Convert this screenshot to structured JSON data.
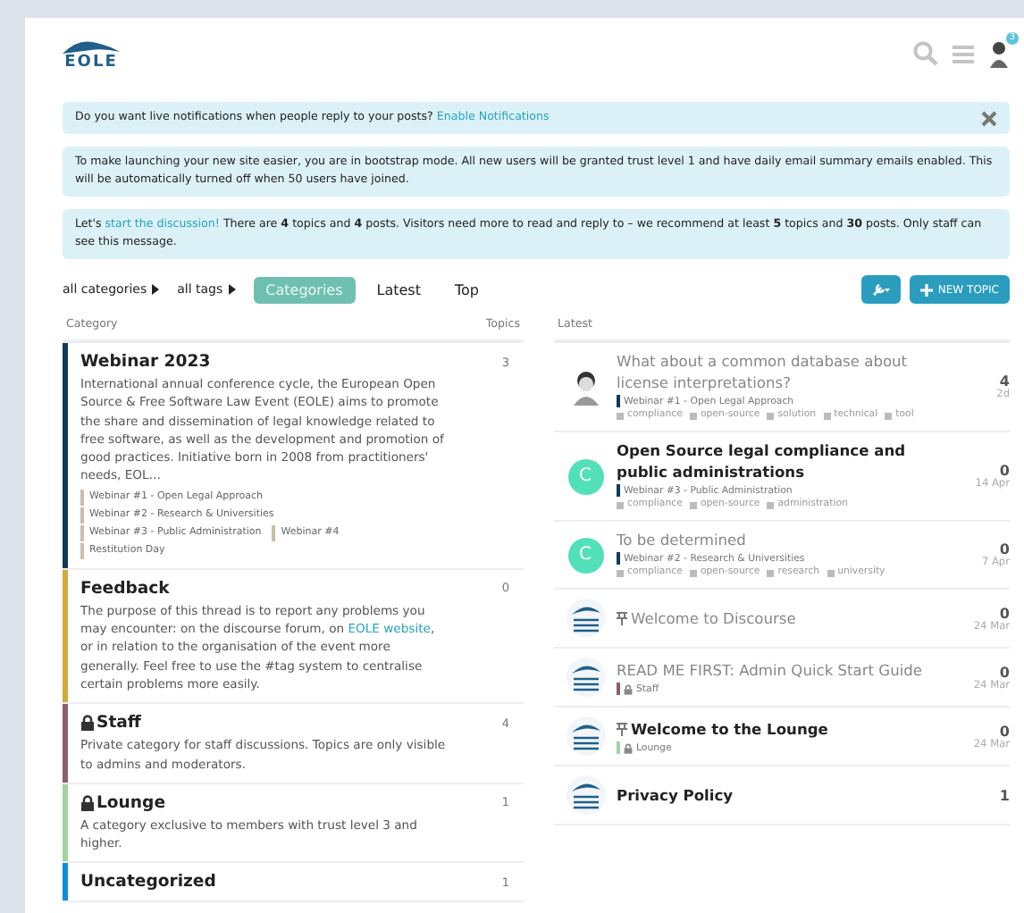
{
  "header": {
    "logo_text": "EOLE",
    "notification_count": "3"
  },
  "banners": [
    {
      "text": "Do you want live notifications when people reply to your posts? ",
      "link": "Enable Notifications",
      "dismissible": true
    },
    {
      "text": "To make launching your new site easier, you are in bootstrap mode. All new users will be granted trust level 1 and have daily email summary emails enabled. This will be automatically turned off when 50 users have joined.",
      "dismissible": false
    },
    {
      "text": "Let's ",
      "link": "start the discussion!",
      "after": " There are **4** topics and **4** posts. Visitors need more to read and reply to – we recommend at least **5** topics and **30** posts. Only staff can see this message.",
      "dismissible": false
    }
  ],
  "nav": {
    "filters": [
      "all categories",
      "all tags"
    ],
    "tabs": [
      {
        "label": "Categories",
        "selected": true
      },
      {
        "label": "Latest",
        "selected": false
      },
      {
        "label": "Top",
        "selected": false
      }
    ],
    "new_topic": "NEW TOPIC"
  },
  "categories": {
    "columns": [
      "Category",
      "Topics"
    ],
    "rows": [
      {
        "name": "Webinar 2023",
        "color": "#123a58",
        "locked": false,
        "topics": "3",
        "description": "International annual conference cycle, the European Open Source & Free Software Law Event (EOLE) aims to promote the share and dissemination of legal knowledge related to free software, as well as the development and promotion of good practices. Initiative born in 2008 from practitioners' needs, EOL…",
        "subcategories": [
          "Webinar #1 - Open Legal Approach",
          "Webinar #2 - Research & Universities",
          "Webinar #3 - Public Administration",
          "Webinar #4",
          "Restitution Day"
        ]
      },
      {
        "name": "Feedback",
        "color": "#d2aa3c",
        "locked": false,
        "topics": "0",
        "description": "The purpose of this thread is to report any problems you may encounter: on the discourse forum, on ",
        "link": "EOLE website",
        "after": ", or in relation to the organisation of the event more generally. Feel free to use the #tag system to centralise certain problems more easily."
      },
      {
        "name": "Staff",
        "color": "#8c5f6e",
        "locked": true,
        "topics": "4",
        "description": "Private category for staff discussions. Topics are only visible to admins and moderators."
      },
      {
        "name": "Lounge",
        "color": "#a3d3a3",
        "locked": true,
        "topics": "1",
        "description": "A category exclusive to members with trust level 3 and higher."
      },
      {
        "name": "Uncategorized",
        "color": "#0b8fd6",
        "locked": false,
        "topics": "1"
      }
    ]
  },
  "latest": {
    "heading": "Latest",
    "topics": [
      {
        "title": "What about a common database about license interpretations?",
        "unread": false,
        "pinned": false,
        "kind": "photo",
        "category": {
          "name": "Webinar #1 - Open Legal Approach",
          "color": "#123a58",
          "locked": false
        },
        "tags": [
          "compliance",
          "open-source",
          "solution",
          "technical",
          "tool"
        ],
        "replies": "4",
        "date": "2d"
      },
      {
        "title": "Open Source legal compliance and public administrations",
        "unread": true,
        "pinned": false,
        "kind": "letter",
        "letter": "C",
        "category": {
          "name": "Webinar #3 - Public Administration",
          "color": "#123a58",
          "locked": false
        },
        "tags": [
          "compliance",
          "open-source",
          "administration"
        ],
        "replies": "0",
        "date": "14 Apr"
      },
      {
        "title": "To be determined",
        "unread": false,
        "pinned": false,
        "kind": "letter",
        "letter": "C",
        "category": {
          "name": "Webinar #2 - Research & Universities",
          "color": "#123a58",
          "locked": false
        },
        "tags": [
          "compliance",
          "open-source",
          "research",
          "university"
        ],
        "replies": "0",
        "date": "7 Apr"
      },
      {
        "title": "Welcome to Discourse",
        "unread": false,
        "pinned": true,
        "kind": "logo",
        "replies": "0",
        "date": "24 Mar"
      },
      {
        "title": "READ ME FIRST: Admin Quick Start Guide",
        "unread": false,
        "pinned": false,
        "kind": "logo",
        "category": {
          "name": "Staff",
          "color": "#8c5f6e",
          "locked": true
        },
        "replies": "0",
        "date": "24 Mar"
      },
      {
        "title": "Welcome to the Lounge",
        "unread": true,
        "pinned": true,
        "kind": "logo",
        "category": {
          "name": "Lounge",
          "color": "#a3d3a3",
          "locked": true
        },
        "replies": "0",
        "date": "24 Mar"
      },
      {
        "title": "Privacy Policy",
        "unread": true,
        "pinned": false,
        "kind": "logo",
        "replies": "1"
      }
    ]
  }
}
